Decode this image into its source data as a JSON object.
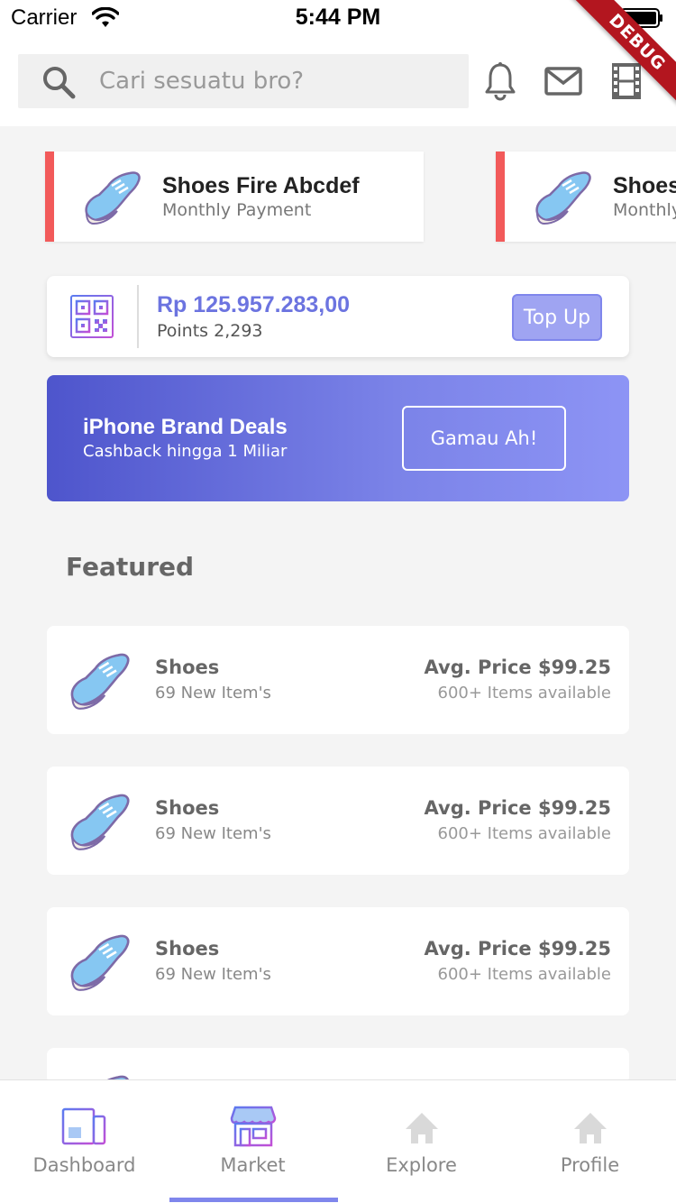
{
  "status_bar": {
    "carrier": "Carrier",
    "time": "5:44 PM"
  },
  "debug_banner": "DEBUG",
  "search": {
    "placeholder": "Cari sesuatu bro?"
  },
  "header_icons": [
    "bell-icon",
    "mail-icon",
    "film-icon"
  ],
  "promo_cards": [
    {
      "title": "Shoes Fire Abcdef",
      "subtitle": "Monthly Payment"
    },
    {
      "title": "Shoes",
      "subtitle": "Monthly"
    }
  ],
  "wallet": {
    "balance": "Rp 125.957.283,00",
    "points": "Points 2,293",
    "topup_label": "Top Up"
  },
  "deal": {
    "title": "iPhone Brand Deals",
    "subtitle": "Cashback hingga 1 Miliar",
    "button_label": "Gamau Ah!"
  },
  "featured": {
    "title": "Featured",
    "items": [
      {
        "name": "Shoes",
        "new_items": "69 New Item's",
        "price": "Avg. Price $99.25",
        "availability": "600+ Items available"
      },
      {
        "name": "Shoes",
        "new_items": "69 New Item's",
        "price": "Avg. Price $99.25",
        "availability": "600+ Items available"
      },
      {
        "name": "Shoes",
        "new_items": "69 New Item's",
        "price": "Avg. Price $99.25",
        "availability": "600+ Items available"
      }
    ]
  },
  "bottom_nav": {
    "items": [
      {
        "label": "Dashboard",
        "icon": "dashboard-icon"
      },
      {
        "label": "Market",
        "icon": "market-icon"
      },
      {
        "label": "Explore",
        "icon": "home-icon"
      },
      {
        "label": "Profile",
        "icon": "home-icon"
      }
    ],
    "active": "Market"
  },
  "colors": {
    "accent": "#7f86ec",
    "promo_border": "#f25a5a",
    "balance_text": "#6c74e0",
    "banner_gradient_start": "#4e55cc",
    "banner_gradient_end": "#8d94f5"
  }
}
